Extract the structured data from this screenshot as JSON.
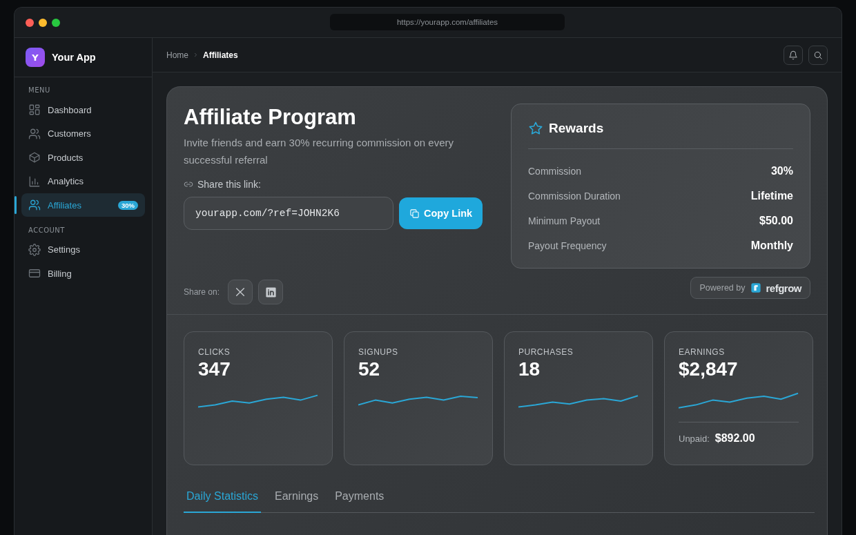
{
  "window": {
    "address": "https://yourapp.com/affiliates"
  },
  "sidebar": {
    "app_initial": "Y",
    "app_name": "Your App",
    "sections": [
      {
        "title": "MENU",
        "items": [
          {
            "label": "Dashboard",
            "selected": false
          },
          {
            "label": "Customers",
            "selected": false
          },
          {
            "label": "Products",
            "selected": false
          },
          {
            "label": "Analytics",
            "selected": false
          },
          {
            "label": "Affiliates",
            "selected": true,
            "badge": "30%"
          }
        ]
      },
      {
        "title": "ACCOUNT",
        "items": [
          {
            "label": "Settings",
            "selected": false
          },
          {
            "label": "Billing",
            "selected": false
          }
        ]
      }
    ]
  },
  "breadcrumb": [
    {
      "label": "Home",
      "current": false
    },
    {
      "label": "Affiliates",
      "current": true
    }
  ],
  "program": {
    "title": "Affiliate Program",
    "description": "Invite friends and earn 30% recurring commission on every successful referral",
    "share_label": "Share this link:",
    "link": "yourapp.com/?ref=JOHN2K6",
    "copy_button": "Copy Link",
    "share_on": "Share on:"
  },
  "rewards": {
    "title": "Rewards",
    "rows": [
      {
        "label": "Commission",
        "value": "30%"
      },
      {
        "label": "Commission Duration",
        "value": "Lifetime"
      },
      {
        "label": "Minimum Payout",
        "value": "$50.00"
      },
      {
        "label": "Payout Frequency",
        "value": "Monthly"
      }
    ]
  },
  "powered_by": {
    "label": "Powered by",
    "brand": "refgrow"
  },
  "stats": [
    {
      "label": "CLICKS",
      "value": "347"
    },
    {
      "label": "SIGNUPS",
      "value": "52"
    },
    {
      "label": "PURCHASES",
      "value": "18"
    },
    {
      "label": "EARNINGS",
      "value": "$2,847",
      "footer_label": "Unpaid:",
      "footer_value": "$892.00"
    }
  ],
  "tabs": [
    {
      "label": "Daily Statistics",
      "selected": true
    },
    {
      "label": "Earnings",
      "selected": false
    },
    {
      "label": "Payments",
      "selected": false
    }
  ]
}
